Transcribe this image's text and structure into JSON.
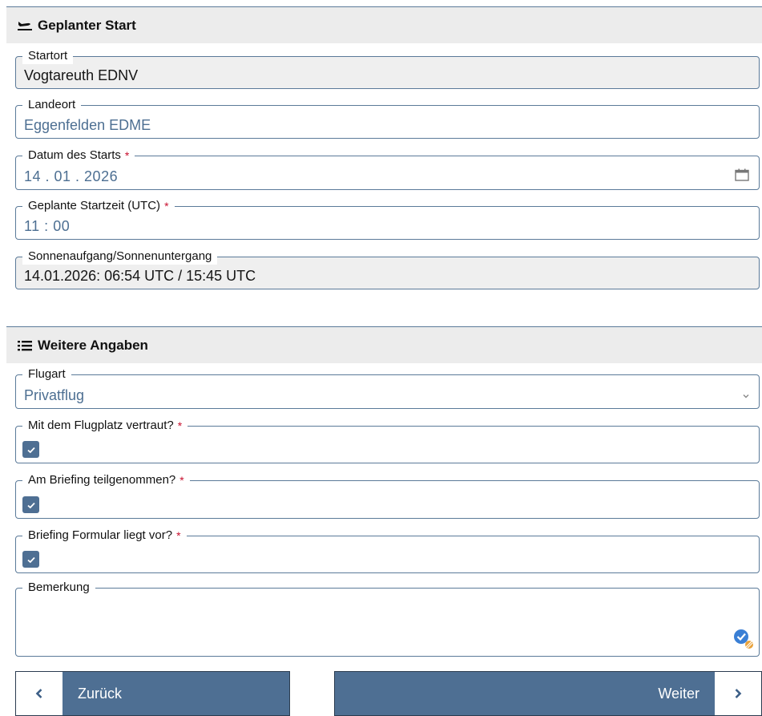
{
  "section_start": {
    "title": "Geplanter Start",
    "icon": "airplane-takeoff-icon"
  },
  "fields": {
    "startort": {
      "label": "Startort",
      "value": "Vogtareuth EDNV"
    },
    "landeort": {
      "label": "Landeort",
      "value": "Eggenfelden EDME"
    },
    "datum": {
      "label": "Datum des Starts",
      "required_mark": "*",
      "value": "14 . 01 . 2026",
      "icon": "calendar-icon"
    },
    "startzeit": {
      "label": "Geplante Startzeit (UTC)",
      "required_mark": "*",
      "value": "11 : 00"
    },
    "sonne": {
      "label": "Sonnenaufgang/Sonnenuntergang",
      "value": "14.01.2026: 06:54 UTC / 15:45 UTC"
    }
  },
  "section_more": {
    "title": "Weitere Angaben",
    "icon": "list-icon"
  },
  "more_fields": {
    "flugart": {
      "label": "Flugart",
      "value": "Privatflug",
      "icon": "chevron-down-icon"
    },
    "vertraut": {
      "label": "Mit dem Flugplatz vertraut?",
      "required_mark": "*",
      "checked": true
    },
    "briefing": {
      "label": "Am Briefing teilgenommen?",
      "required_mark": "*",
      "checked": true
    },
    "formular": {
      "label": "Briefing Formular liegt vor?",
      "required_mark": "*",
      "checked": true
    },
    "bemerkung": {
      "label": "Bemerkung",
      "value": ""
    }
  },
  "buttons": {
    "back": {
      "label": "Zurück",
      "icon": "chevron-left-icon"
    },
    "next": {
      "label": "Weiter",
      "icon": "chevron-right-icon"
    }
  },
  "colors": {
    "accent": "#4e6f93",
    "border": "#5b7a99",
    "required": "#c8102e",
    "header_bg": "#ececec",
    "readonly_bg": "#efefef"
  }
}
